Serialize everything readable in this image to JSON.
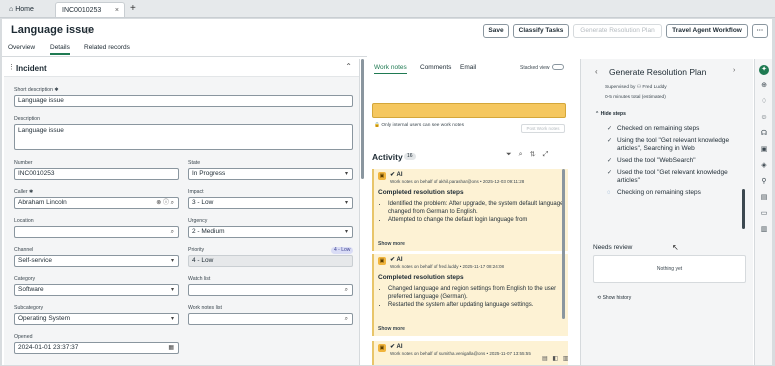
{
  "tabs": {
    "home": "Home",
    "incident": "INC0010253"
  },
  "header": {
    "title": "Language issue",
    "buttons": {
      "save": "Save",
      "classify": "Classify Tasks",
      "generate": "Generate Resolution Plan",
      "travel": "Travel Agent Workflow",
      "more": "···"
    }
  },
  "subtabs": [
    "Overview",
    "Details",
    "Related records"
  ],
  "form": {
    "section": "Incident",
    "short_description": {
      "label": "Short description",
      "value": "Language issue"
    },
    "description": {
      "label": "Description",
      "value": "Language issue"
    },
    "number": {
      "label": "Number",
      "value": "INC0010253"
    },
    "state": {
      "label": "State",
      "value": "In Progress"
    },
    "caller": {
      "label": "Caller",
      "value": "Abraham Lincoln"
    },
    "impact": {
      "label": "Impact",
      "value": "3 - Low"
    },
    "location": {
      "label": "Location",
      "value": ""
    },
    "urgency": {
      "label": "Urgency",
      "value": "2 - Medium"
    },
    "channel": {
      "label": "Channel",
      "value": "Self-service"
    },
    "priority": {
      "label": "Priority",
      "value": "4 - Low",
      "badge": "4 - Low"
    },
    "category": {
      "label": "Category",
      "value": "Software"
    },
    "watch_list": {
      "label": "Watch list",
      "value": ""
    },
    "subcategory": {
      "label": "Subcategory",
      "value": "Operating System"
    },
    "work_notes_list": {
      "label": "Work notes list",
      "value": ""
    },
    "opened": {
      "label": "Opened",
      "value": "2024-01-01 23:37:37"
    }
  },
  "notes": {
    "tabs": [
      "Work notes",
      "Comments",
      "Email"
    ],
    "stacked": "Stacked view",
    "visibility": "Only internal users can see work notes",
    "post": "Post Work notes",
    "activity": "Activity",
    "count": "16",
    "cards": [
      {
        "who": "AI",
        "meta": "Work notes on behalf of akhil.parashar@ons  •  2025-12-03 09:11:28",
        "title": "Completed resolution steps",
        "bullets": [
          "Identified the problem: After upgrade, the system default language changed from German to English.",
          "Attempted to change the default login language from"
        ],
        "more": "Show more"
      },
      {
        "who": "AI",
        "meta": "Work notes on behalf of fred.luddy  •  2025-11-17 08:24:08",
        "title": "Completed resolution steps",
        "bullets": [
          "Changed language and region settings from English to the user preferred language (German).",
          "Restarted the system after updating language settings."
        ],
        "more": "Show more"
      },
      {
        "who": "AI",
        "meta": "Work notes on behalf of sumitha.venigalla@ons  •  2025-11-07 13:55:55",
        "title": "",
        "bullets": [],
        "more": ""
      }
    ]
  },
  "panel": {
    "title": "Generate Resolution Plan",
    "supervised": "Supervised by",
    "supervisor": "Fred Luddy",
    "eta": "0-5 minutes total (estimated)",
    "hide": "Hide steps",
    "steps": [
      "Checked on remaining steps",
      "Using the tool \"Get relevant knowledge articles\", Searching in Web",
      "Used the tool \"WebSearch\"",
      "Used the tool \"Get relevant knowledge articles\"",
      "Checking on remaining steps"
    ],
    "review": "Needs review",
    "nothing": "Nothing yet",
    "history": "Show history"
  }
}
